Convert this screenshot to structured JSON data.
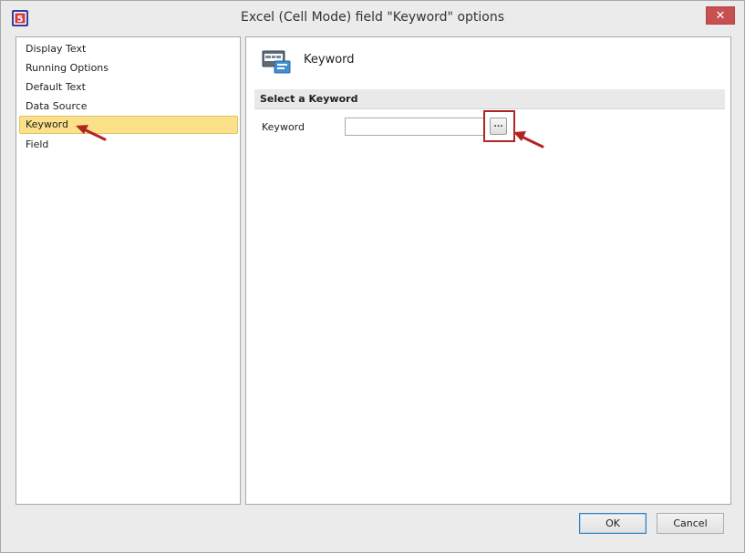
{
  "window": {
    "title": "Excel (Cell Mode) field \"Keyword\" options",
    "close_label": "✕",
    "app_icon": "app-logo-icon"
  },
  "sidebar": {
    "items": [
      {
        "label": "Display Text",
        "selected": false
      },
      {
        "label": "Running Options",
        "selected": false
      },
      {
        "label": "Default Text",
        "selected": false
      },
      {
        "label": "Data Source",
        "selected": false
      },
      {
        "label": "Keyword",
        "selected": true
      },
      {
        "label": "Field",
        "selected": false
      }
    ]
  },
  "content": {
    "header_title": "Keyword",
    "header_icon": "keyword-field-icon",
    "section_title": "Select a Keyword",
    "keyword_label": "Keyword",
    "keyword_value": "",
    "browse_label": "..."
  },
  "footer": {
    "ok_label": "OK",
    "cancel_label": "Cancel"
  },
  "colors": {
    "selection": "#fbe28a",
    "annotation": "#b22424",
    "close": "#c75050"
  }
}
